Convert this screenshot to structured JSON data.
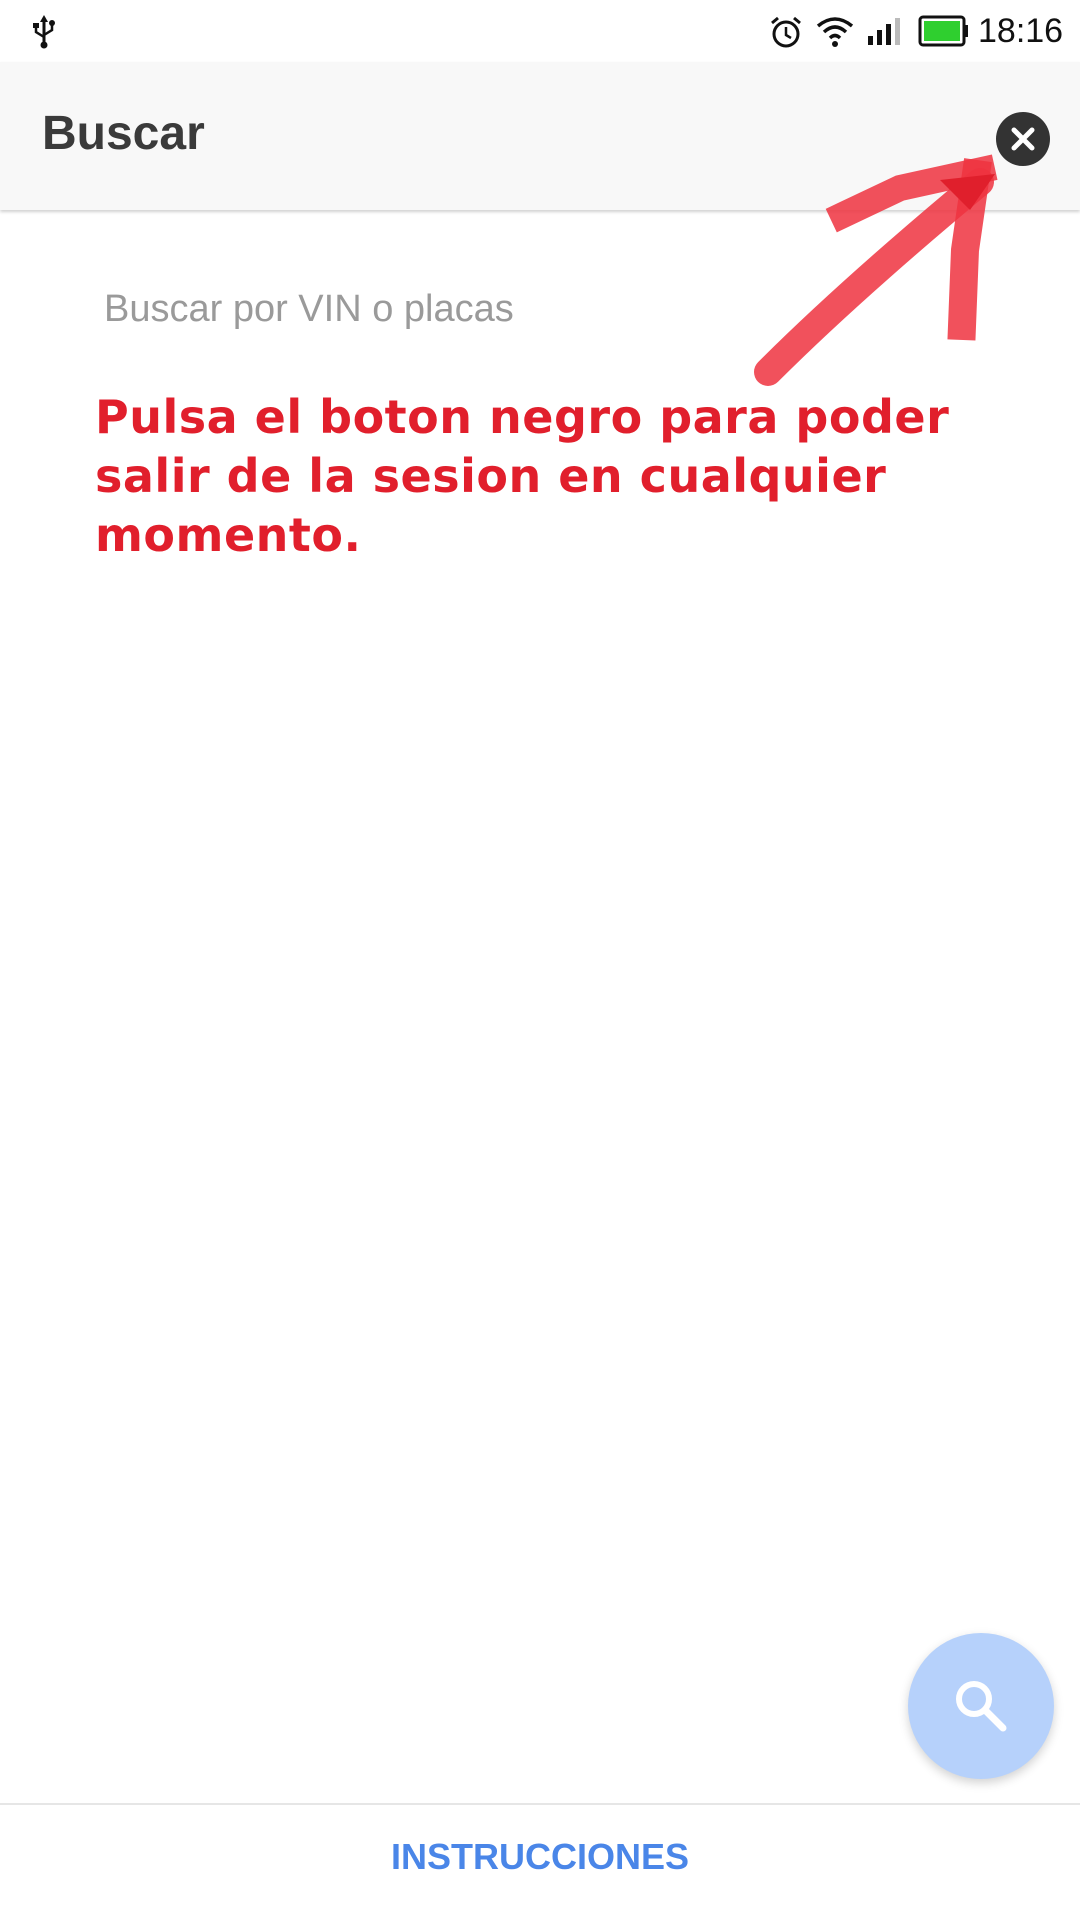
{
  "status_bar": {
    "time": "18:16",
    "icons": [
      "usb-icon",
      "alarm-icon",
      "wifi-icon",
      "signal-icon",
      "battery-icon"
    ],
    "battery_color": "#2fcf2f"
  },
  "toolbar": {
    "title": "Buscar",
    "close_icon": "close-circle-icon"
  },
  "search": {
    "placeholder": "Buscar por VIN o placas",
    "value": ""
  },
  "annotation": {
    "text": "Pulsa el boton negro para poder salir de la sesion en cualquier momento.",
    "color": "#e11f2c",
    "arrow_icon": "annotation-arrow-icon"
  },
  "fab": {
    "icon": "search-icon",
    "color": "#b6d1fb"
  },
  "bottom_bar": {
    "instructions_label": "INSTRUCCIONES",
    "accent": "#4a86e8"
  }
}
